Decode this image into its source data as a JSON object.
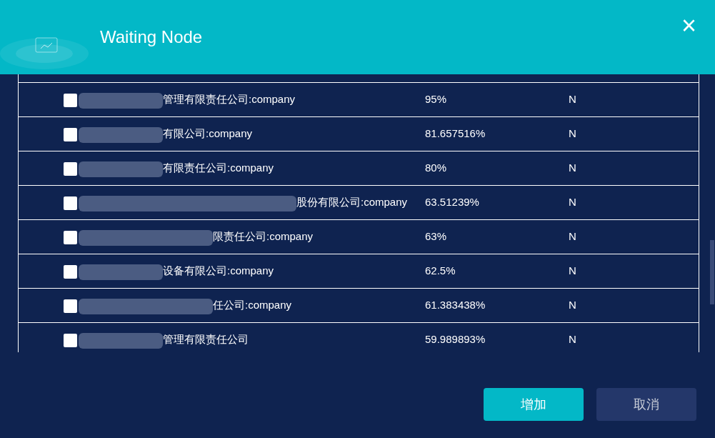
{
  "dialog": {
    "title": "Waiting Node",
    "close": "×"
  },
  "rows": [
    {
      "checked": false,
      "kind": "short",
      "name": "管理有限责任公司:company",
      "score": "95%",
      "flag": "N"
    },
    {
      "checked": false,
      "kind": "short",
      "name": "有限公司:company",
      "score": "81.657516%",
      "flag": "N"
    },
    {
      "checked": false,
      "kind": "short",
      "name": "有限责任公司:company",
      "score": "80%",
      "flag": "N"
    },
    {
      "checked": false,
      "kind": "long",
      "name": "股份有限公司:company",
      "score": "63.51239%",
      "flag": "N"
    },
    {
      "checked": false,
      "kind": "medium",
      "name": "限责任公司:company",
      "score": "63%",
      "flag": "N"
    },
    {
      "checked": false,
      "kind": "short",
      "name": "设备有限公司:company",
      "score": "62.5%",
      "flag": "N"
    },
    {
      "checked": false,
      "kind": "medium",
      "name": "任公司:company",
      "score": "61.383438%",
      "flag": "N"
    },
    {
      "checked": false,
      "kind": "short",
      "name": "管理有限责任公司",
      "score": "59.989893%",
      "flag": "N"
    }
  ],
  "buttons": [
    {
      "label": "增加",
      "kind": "primary"
    },
    {
      "label": "取消",
      "kind": "secondary"
    }
  ]
}
